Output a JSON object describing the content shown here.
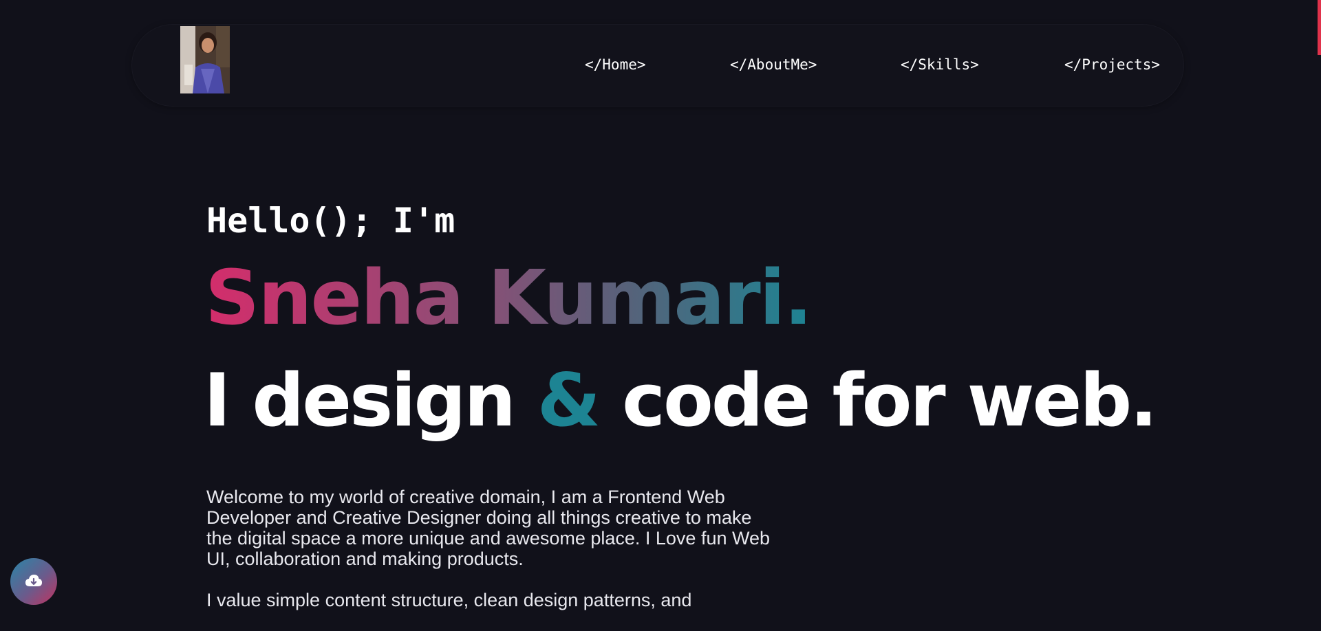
{
  "nav": {
    "links": [
      {
        "label": "</Home>"
      },
      {
        "label": "</AboutMe>"
      },
      {
        "label": "</Skills>"
      },
      {
        "label": "</Projects>"
      }
    ]
  },
  "hero": {
    "greeting": "Hello(); I'm",
    "name": "Sneha Kumari.",
    "tagline_part1": "I design ",
    "tagline_amp": "&",
    "tagline_part2": " code for web.",
    "intro_paragraph_1": "Welcome to my world of creative domain, I am a Frontend Web Developer and Creative Designer doing all things creative to make the digital space a more unique and awesome place. I Love fun Web UI, collaboration and making products.",
    "intro_paragraph_2": "I value simple content structure, clean design patterns, and"
  },
  "icons": {
    "download": "cloud-download-icon",
    "avatar": "profile-photo"
  },
  "colors": {
    "background": "#11111a",
    "accent_teal": "#1d8493",
    "accent_pink": "#d42d6b",
    "scroll_indicator": "#e0324b"
  }
}
